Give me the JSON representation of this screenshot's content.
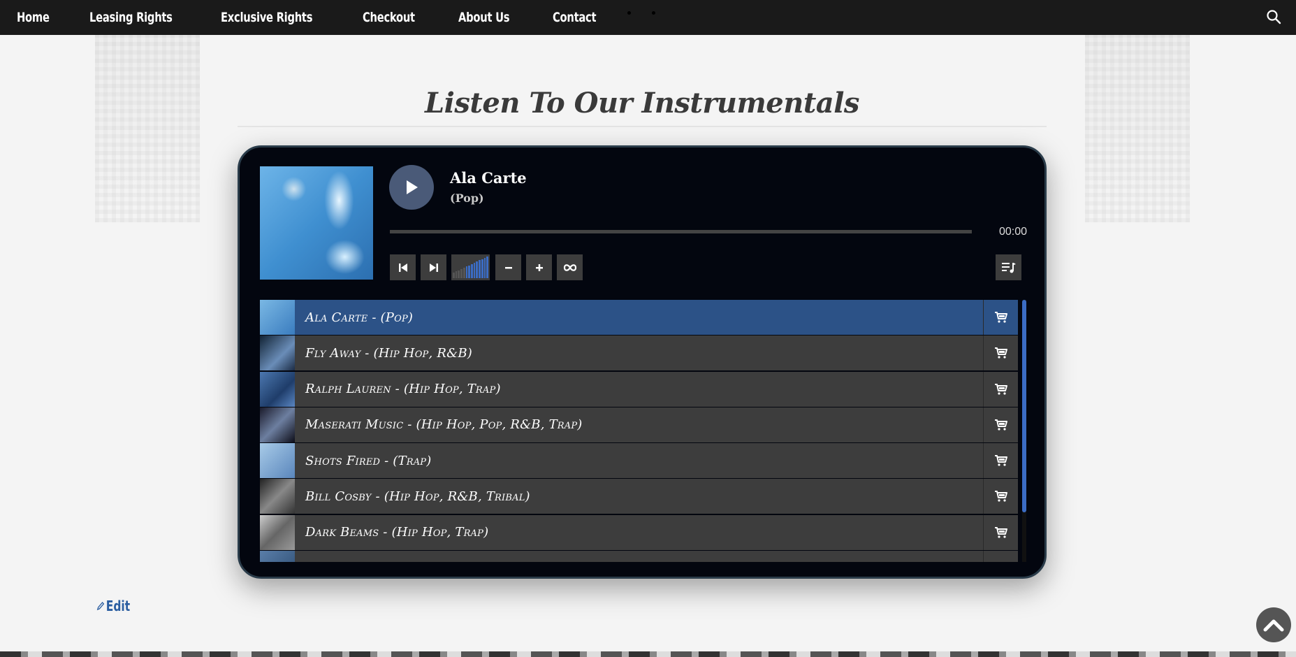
{
  "nav": {
    "items": [
      {
        "label": "Home"
      },
      {
        "label": "Leasing Rights"
      },
      {
        "label": "Exclusive Rights"
      },
      {
        "label": "Checkout"
      },
      {
        "label": "About Us"
      },
      {
        "label": "Contact"
      }
    ],
    "search_icon": "search-icon"
  },
  "page": {
    "title": "Listen To Our Instrumentals",
    "edit_label": "Edit"
  },
  "player": {
    "now_playing": {
      "title": "Ala Carte",
      "genre": "(Pop)",
      "time": "00:00",
      "progress": 0
    },
    "controls": {
      "prev_icon": "skip-back-icon",
      "next_icon": "skip-forward-icon",
      "volume_down_icon": "minus-icon",
      "volume_up_icon": "plus-icon",
      "loop_icon": "infinity-icon",
      "playlist_icon": "playlist-music-icon"
    },
    "volume_level": 0.7,
    "accent_color": "#2c5287",
    "playlist": [
      {
        "label": "Ala Carte - (Pop)",
        "active": true
      },
      {
        "label": "Fly Away - (Hip Hop, R&B)",
        "active": false
      },
      {
        "label": "Ralph Lauren - (Hip Hop, Trap)",
        "active": false
      },
      {
        "label": "Maserati Music - (Hip Hop, Pop, R&B, Trap)",
        "active": false
      },
      {
        "label": "Shots Fired - (Trap)",
        "active": false
      },
      {
        "label": "Bill Cosby - (Hip Hop, R&B, Tribal)",
        "active": false
      },
      {
        "label": "Dark Beams - (Hip Hop, Trap)",
        "active": false
      },
      {
        "label": "",
        "active": false
      }
    ]
  }
}
